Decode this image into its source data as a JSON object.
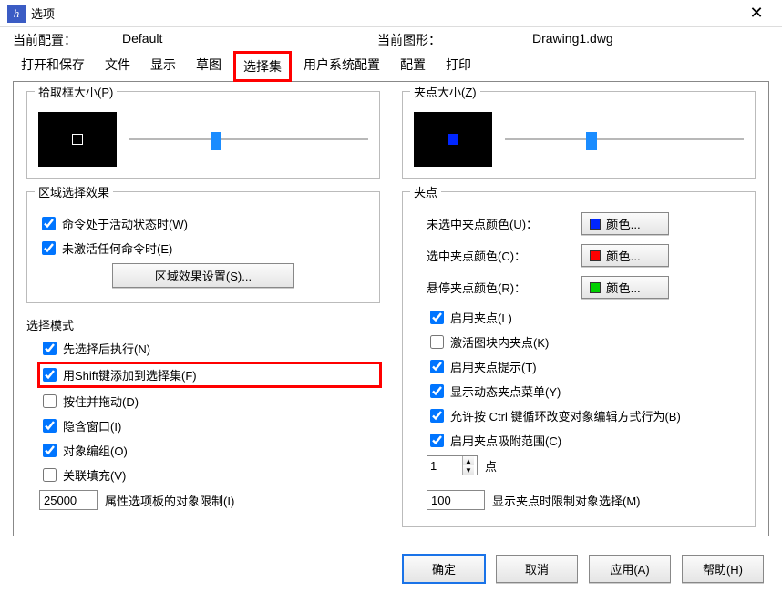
{
  "window": {
    "title": "选项"
  },
  "info": {
    "config_label": "当前配置：",
    "config_value": "Default",
    "drawing_label": "当前图形：",
    "drawing_value": "Drawing1.dwg"
  },
  "tabs": {
    "open_save": "打开和保存",
    "files": "文件",
    "display": "显示",
    "draft": "草图",
    "selection": "选择集",
    "user_config": "用户系统配置",
    "config": "配置",
    "print": "打印"
  },
  "pickbox": {
    "title": "拾取框大小(P)",
    "slider_pct": 34
  },
  "gripsize": {
    "title": "夹点大小(Z)",
    "slider_pct": 34
  },
  "region_effect": {
    "title": "区域选择效果",
    "active_cmd": "命令处于活动状态时(W)",
    "inactive_cmd": "未激活任何命令时(E)",
    "settings_btn": "区域效果设置(S)..."
  },
  "select_mode": {
    "title": "选择模式",
    "noun_verb": "先选择后执行(N)",
    "shift_add": "用Shift键添加到选择集(F)",
    "press_drag": "按住并拖动(D)",
    "implied_window": "隐含窗口(I)",
    "object_group": "对象编组(O)",
    "assoc_hatch": "关联填充(V)",
    "limit_value": "25000",
    "limit_label": "属性选项板的对象限制(I)"
  },
  "grip": {
    "title": "夹点",
    "unselected_label": "未选中夹点颜色(U)：",
    "selected_label": "选中夹点颜色(C)：",
    "hover_label": "悬停夹点颜色(R)：",
    "color_text": "颜色...",
    "enable_grip": "启用夹点(L)",
    "block_grip": "激活图块内夹点(K)",
    "grip_tip": "启用夹点提示(T)",
    "dyn_menu": "显示动态夹点菜单(Y)",
    "ctrl_cycle": "允许按 Ctrl 键循环改变对象编辑方式行为(B)",
    "grip_snap": "启用夹点吸附范围(C)",
    "point_value": "1",
    "point_label": "点",
    "limit_value": "100",
    "limit_label": "显示夹点时限制对象选择(M)"
  },
  "buttons": {
    "ok": "确定",
    "cancel": "取消",
    "apply": "应用(A)",
    "help": "帮助(H)"
  },
  "colors": {
    "unselected": "#0026ff",
    "selected": "#ff0000",
    "hover": "#00d000"
  }
}
